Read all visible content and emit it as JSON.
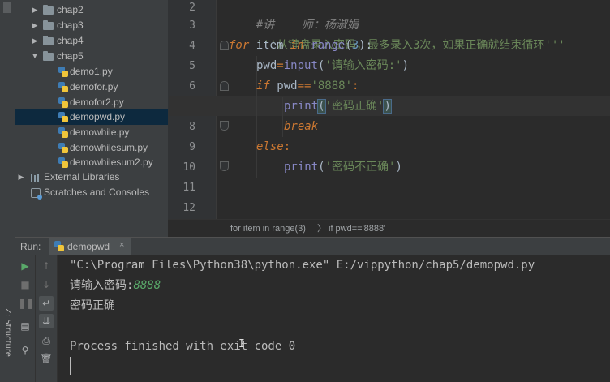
{
  "project_tree": {
    "items": [
      {
        "label": "chap2",
        "type": "folder",
        "expanded": false
      },
      {
        "label": "chap3",
        "type": "folder",
        "expanded": false
      },
      {
        "label": "chap4",
        "type": "folder",
        "expanded": false
      },
      {
        "label": "chap5",
        "type": "folder",
        "expanded": true
      },
      {
        "label": "demo1.py",
        "type": "python-file"
      },
      {
        "label": "demofor.py",
        "type": "python-file"
      },
      {
        "label": "demofor2.py",
        "type": "python-file"
      },
      {
        "label": "demopwd.py",
        "type": "python-file",
        "selected": true
      },
      {
        "label": "demowhile.py",
        "type": "python-file"
      },
      {
        "label": "demowhilesum.py",
        "type": "python-file"
      },
      {
        "label": "demowhilesum2.py",
        "type": "python-file"
      },
      {
        "label": "External Libraries",
        "type": "library"
      },
      {
        "label": "Scratches and Consoles",
        "type": "scratches"
      }
    ]
  },
  "editor": {
    "line_numbers": [
      "2",
      "3",
      "4",
      "5",
      "6",
      "7",
      "8",
      "9",
      "10",
      "11",
      "12"
    ],
    "code": {
      "l2": "#讲    师：杨淑娟",
      "l3": "'''从键盘录入密码，最多录入3次，如果正确就结束循环'''",
      "l4_kw": "for",
      "l4_var": " item ",
      "l4_in": "in",
      "l4_fn": " range",
      "l4_open": "(",
      "l4_num": "3",
      "l4_close": "):",
      "l5_var": "pwd",
      "l5_eq": "=",
      "l5_fn": "input",
      "l5_open": "(",
      "l5_str": "'请输入密码:'",
      "l5_close": ")",
      "l6_kw": "if",
      "l6_var": " pwd",
      "l6_eq": "==",
      "l6_str": "'8888'",
      "l6_colon": ":",
      "l7_fn": "print",
      "l7_open": "(",
      "l7_str": "'密码正确'",
      "l7_close": ")",
      "l8_kw": "break",
      "l9_kw": "else",
      "l9_colon": ":",
      "l10_fn": "print",
      "l10_open": "(",
      "l10_str": "'密码不正确'",
      "l10_close": ")"
    }
  },
  "breadcrumb": {
    "items": [
      "for item in range(3)",
      "if pwd=='8888'"
    ],
    "separator": "〉"
  },
  "run_panel": {
    "label": "Run:",
    "tab_label": "demopwd",
    "tab_close": "×",
    "output": {
      "command": "\"C:\\Program Files\\Python38\\python.exe\" E:/vippython/chap5/demopwd.py",
      "prompt": "请输入密码:",
      "user_input": "8888",
      "result": "密码正确",
      "exit_message": "Process finished with exit code 0"
    }
  },
  "left_strip": {
    "structure_tab": "Z: Structure"
  },
  "colors": {
    "background": "#2b2b2b",
    "panel": "#3c3f41",
    "keyword": "#cc7832",
    "string": "#6a8759",
    "number": "#6897bb",
    "builtin": "#8888c6",
    "console_input": "#59a869",
    "selection": "#0d293e"
  }
}
